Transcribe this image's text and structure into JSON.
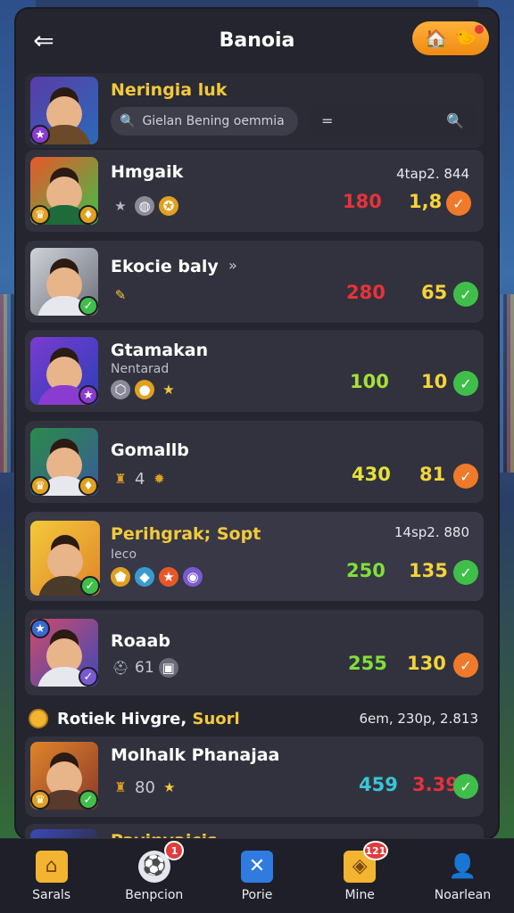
{
  "header": {
    "title": "Banoia",
    "back_icon": "back-arrow-icon"
  },
  "featured": {
    "name": "Neringia luk",
    "search_placeholder": "Gielan Bening oemmia",
    "search2_value": "="
  },
  "rows": [
    {
      "name": "Hmgaik",
      "sub": "",
      "corner": "4tap2. 844",
      "score1": "180",
      "score1_color": "#e8323a",
      "score2": "1,8",
      "check": "orange"
    },
    {
      "name": "Ekocie baly",
      "sub": "",
      "corner": "",
      "score1": "280",
      "score1_color": "#e8323a",
      "score2": "65",
      "check": "green"
    },
    {
      "name": "Gtamakan",
      "sub": "Nentarad",
      "corner": "",
      "score1": "100",
      "score1_color": "#a6e03a",
      "score2": "10",
      "check": "green"
    },
    {
      "name": "Gomallb",
      "sub": "",
      "corner": "",
      "score1": "430",
      "score1_color": "#e4e23a",
      "score2": "81",
      "check": "orange"
    },
    {
      "name": "Perihgrak; Sopt",
      "sub": "Ieco",
      "corner": "14sp2. 880",
      "score1": "250",
      "score1_color": "#7fe03a",
      "score2": "135",
      "check": "green"
    },
    {
      "name": "Roaab",
      "sub": "",
      "corner": "",
      "score1": "255",
      "score1_color": "#7fe03a",
      "score2": "130",
      "check": "orange"
    }
  ],
  "row_icon_text": {
    "gomallb": "4",
    "roaab": "61",
    "ekocie": "»"
  },
  "section": {
    "title_white": "Rotiek Hivgre,",
    "title_gold": "Suorl",
    "right": "6em, 230p, 2.813"
  },
  "section_row": {
    "name": "Molhalk Phanajaa",
    "icon_text": "80",
    "score1": "459",
    "score1_color": "#39c6d6",
    "score2": "3.39",
    "score2_color": "#e8323a",
    "check": "green"
  },
  "partial_row": {
    "name": "Pavinyaicis"
  },
  "nav": [
    {
      "label": "Sarals",
      "icon": "home-icon"
    },
    {
      "label": "Benpcion",
      "icon": "ball-icon",
      "badge": "1"
    },
    {
      "label": "Porie",
      "icon": "cross-icon"
    },
    {
      "label": "Mine",
      "icon": "card-icon",
      "badge": "121"
    },
    {
      "label": "Noarlean",
      "icon": "user-icon"
    }
  ],
  "colors": {
    "green_check": "#3fbf4a",
    "orange_check": "#f07a2a",
    "gold": "#f3d43a",
    "panel": "#25252f",
    "card": "#32323e"
  }
}
